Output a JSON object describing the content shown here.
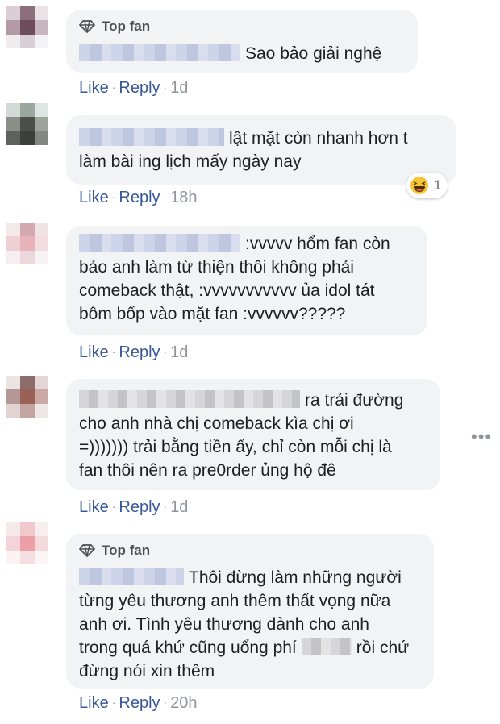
{
  "badge": {
    "label": "Top fan"
  },
  "actions": {
    "like": "Like",
    "reply": "Reply",
    "separator": "·"
  },
  "reaction": {
    "count": "1",
    "icon": "haha-emoji-icon"
  },
  "more_icon": "more-options-icon",
  "comments": [
    {
      "lines": [
        "Sao bảo giải nghệ"
      ],
      "time": "1d"
    },
    {
      "lines": [
        "lật mặt còn nhanh hơn t",
        "làm bài ing lịch mấy ngày nay"
      ],
      "time": "18h"
    },
    {
      "lines": [
        ":vvvvv hổm fan còn",
        "bảo anh làm từ thiện thôi không phải",
        "comeback thật, :vvvvvvvvvvv ủa idol tát",
        "bôm bốp vào mặt fan :vvvvvv?????"
      ],
      "time": "1d"
    },
    {
      "lines": [
        "ra trải đường",
        "cho anh nhà chị comeback kìa chị ơi",
        "=))))))) trải bằng tiền ấy, chỉ còn mỗi chị là",
        "fan thôi nên ra pre0rder ủng hộ đê"
      ],
      "time": "1d"
    },
    {
      "lines": [
        "Thôi đừng làm những người",
        "từng yêu thương anh thêm thất vọng nữa",
        "anh ơi. Tình yêu thương dành cho anh",
        "trong quá khứ cũng uổng phí",
        "rồi chứ",
        "đừng nói xin thêm"
      ],
      "time": "20h"
    }
  ]
}
